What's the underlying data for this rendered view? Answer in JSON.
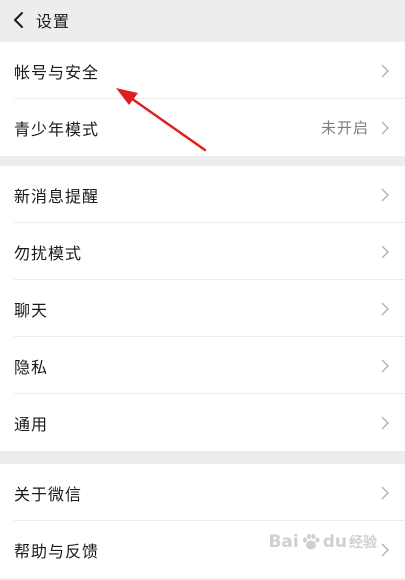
{
  "header": {
    "title": "设置",
    "back_icon": "chevron-left-icon"
  },
  "groups": [
    {
      "items": [
        {
          "label": "帐号与安全",
          "value": ""
        },
        {
          "label": "青少年模式",
          "value": "未开启"
        }
      ]
    },
    {
      "items": [
        {
          "label": "新消息提醒",
          "value": ""
        },
        {
          "label": "勿扰模式",
          "value": ""
        },
        {
          "label": "聊天",
          "value": ""
        },
        {
          "label": "隐私",
          "value": ""
        },
        {
          "label": "通用",
          "value": ""
        }
      ]
    },
    {
      "items": [
        {
          "label": "关于微信",
          "value": ""
        },
        {
          "label": "帮助与反馈",
          "value": ""
        }
      ]
    }
  ],
  "annotation": {
    "arrow_color": "#e02020"
  },
  "watermark": {
    "brand": "Bai",
    "brand_suffix": "du",
    "sub": "经验"
  },
  "colors": {
    "background": "#ededed",
    "card": "#ffffff",
    "chevron": "#b2b2b2",
    "value_text": "#7f7f7f"
  }
}
